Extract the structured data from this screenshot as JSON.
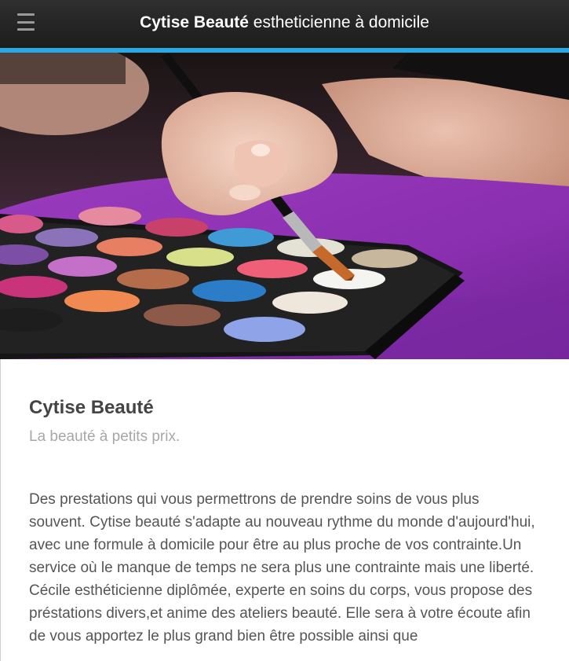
{
  "header": {
    "title_bold": "Cytise Beauté",
    "title_rest": " estheticienne à domicile",
    "accent_color": "#29a8e6",
    "menu_icon": "hamburger-menu-icon"
  },
  "hero": {
    "image": "makeup-palette-with-brush-photo"
  },
  "main": {
    "title": "Cytise Beauté",
    "tagline": "La beauté à petits prix.",
    "paragraphs": [
      "Des prestations qui vous permettrons de prendre soins de vous plus souvent. Cytise beauté s'adapte au nouveau rythme du monde d'aujourd'hui, avec une formule à domicile pour être au plus proche de vos contrainte.Un service où le manque de temps ne sera plus une contrainte mais une liberté.",
      "Cécile esthéticienne diplômée, experte en soins du corps, vous propose des préstations divers,et anime des ateliers beauté. Elle sera à votre écoute afin de vous apportez le plus grand bien être possible ainsi que"
    ]
  }
}
